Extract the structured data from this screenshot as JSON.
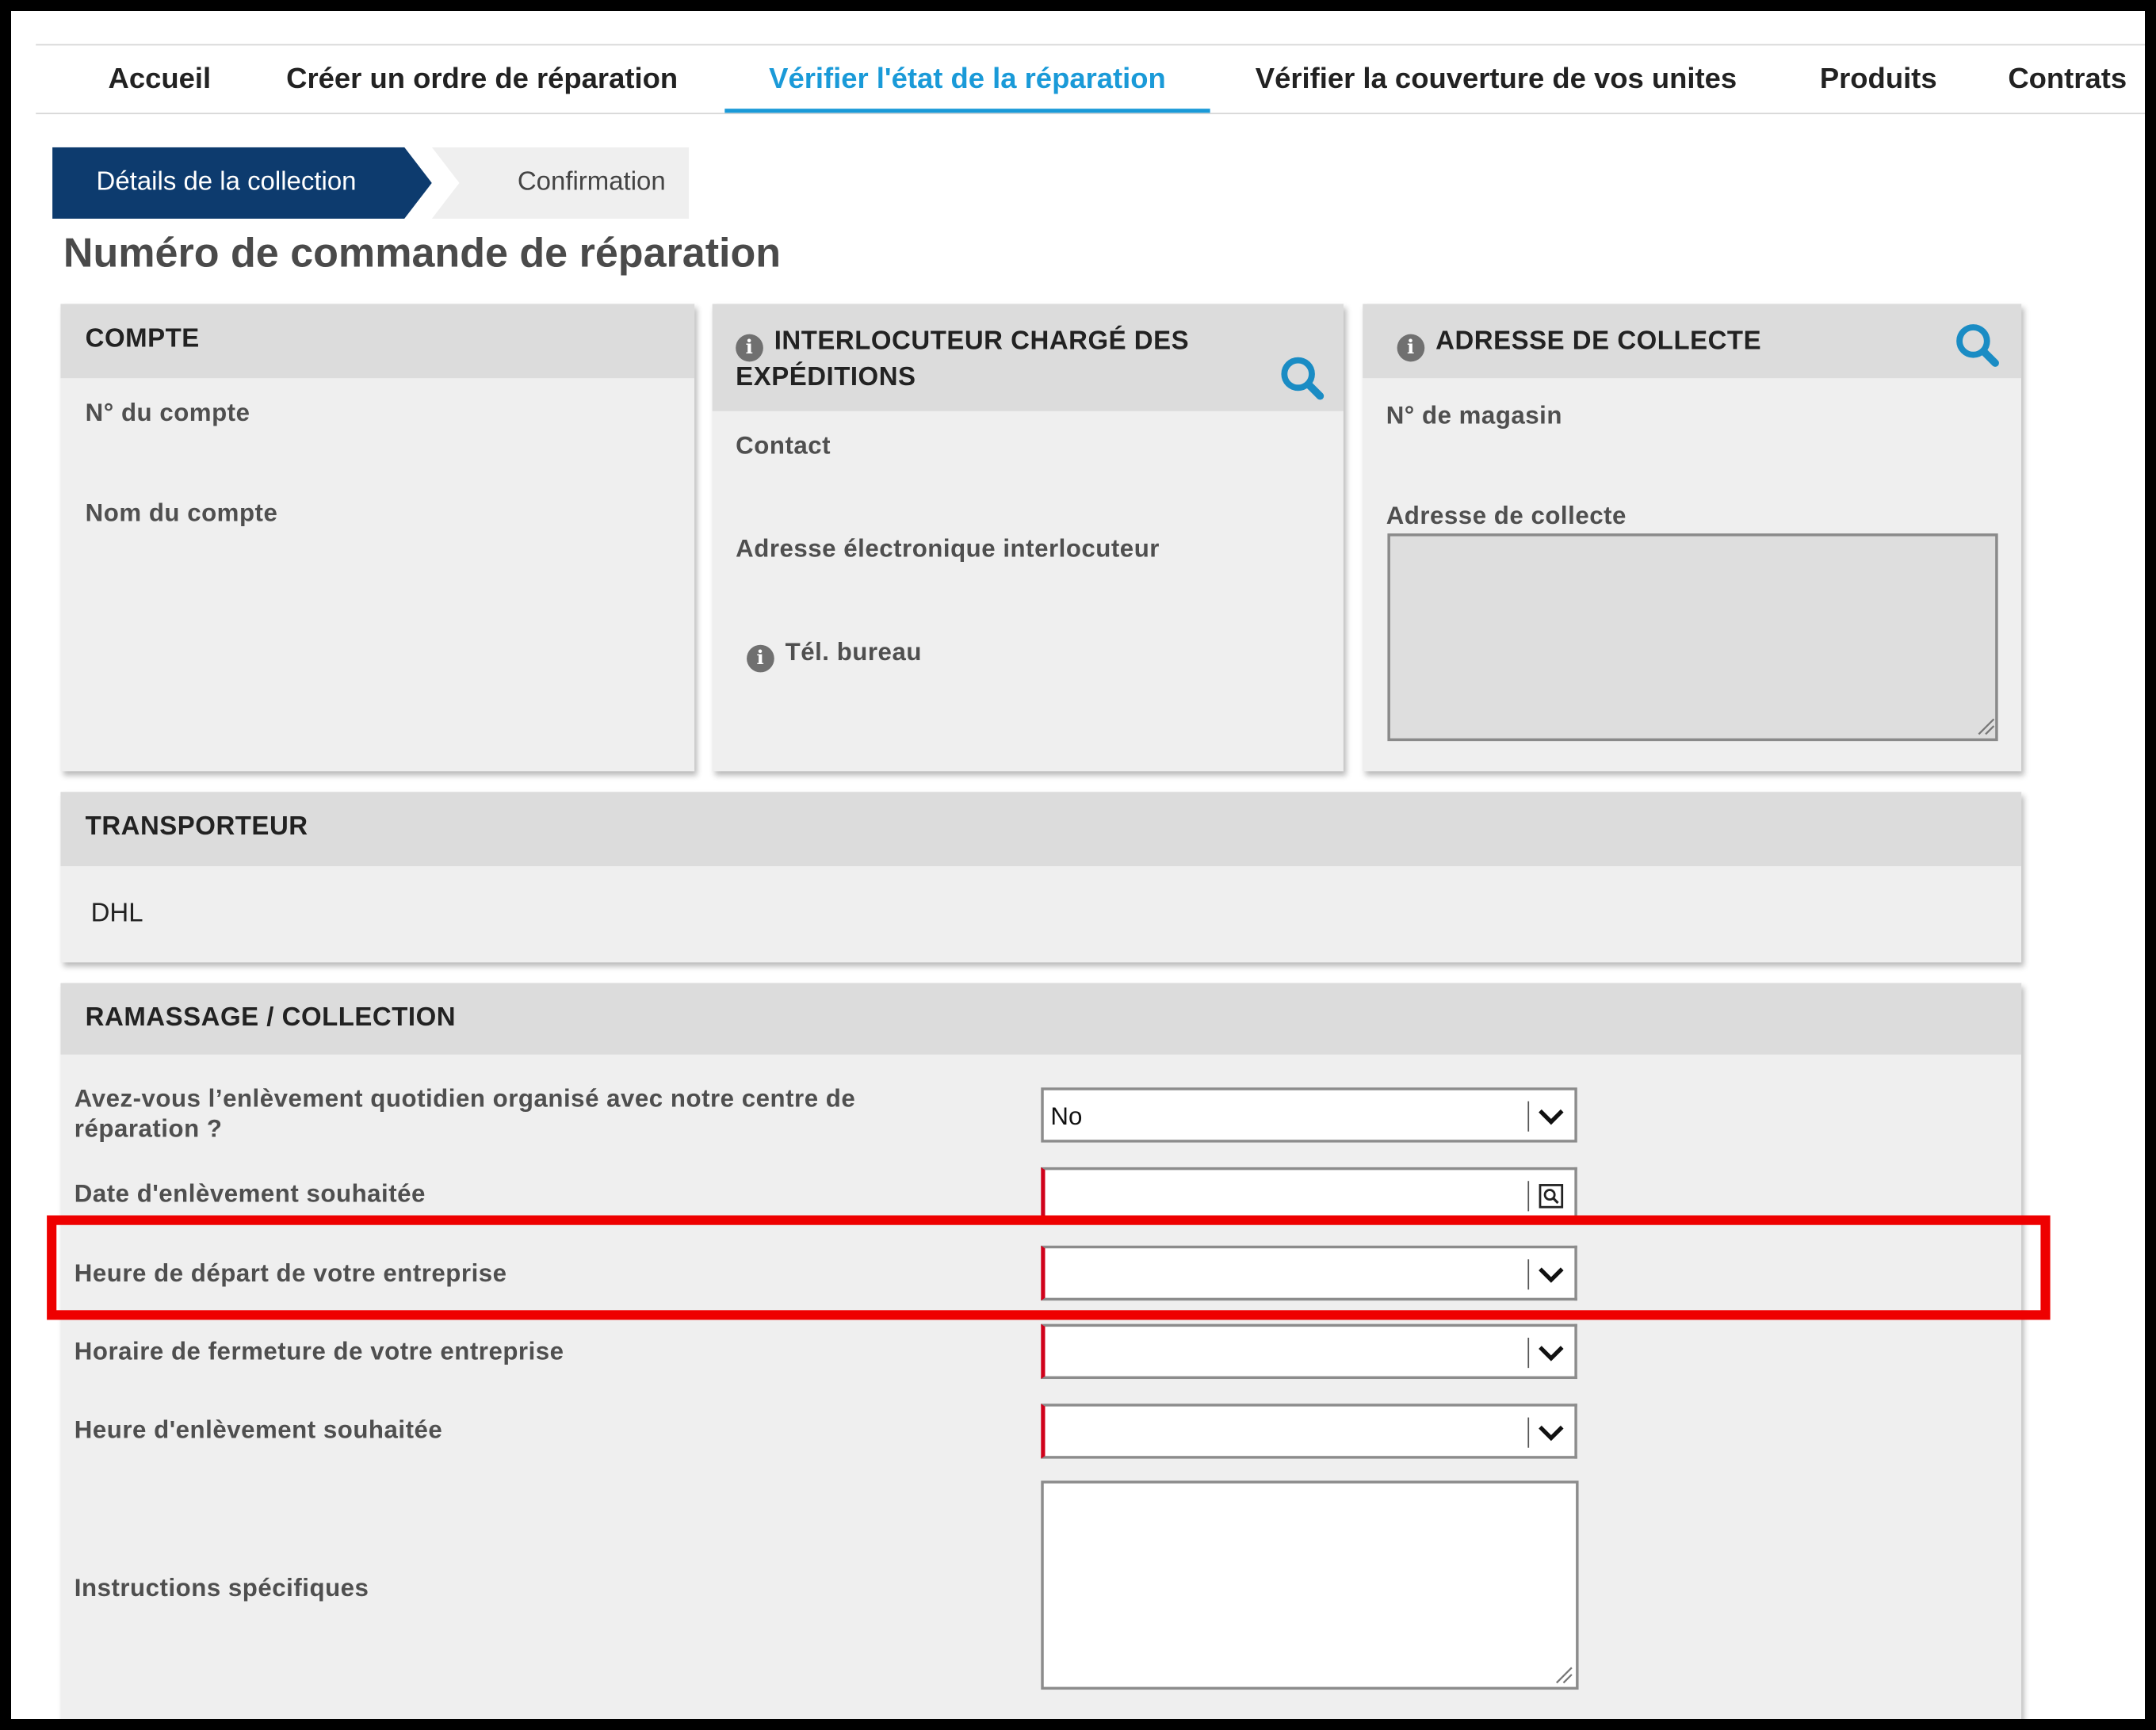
{
  "nav": {
    "items": [
      {
        "label": "Accueil"
      },
      {
        "label": "Créer un ordre de réparation"
      },
      {
        "label": "Vérifier l'état de la réparation"
      },
      {
        "label": "Vérifier la couverture de vos unites"
      },
      {
        "label": "Produits"
      },
      {
        "label": "Contrats"
      }
    ],
    "active_index": 2,
    "accent_color": "#1a9ad8"
  },
  "steps": {
    "current": "Détails de la collection",
    "next": "Confirmation",
    "active_color": "#0d3b6e"
  },
  "page_title": "Numéro de commande de réparation",
  "account": {
    "title": "COMPTE",
    "account_number_label": "N° du compte",
    "account_name_label": "Nom du compte"
  },
  "shipping_contact": {
    "title": "INTERLOCUTEUR CHARGÉ DES EXPÉDITIONS",
    "contact_label": "Contact",
    "email_label": "Adresse électronique interlocuteur",
    "phone_label": "Tél. bureau"
  },
  "pickup_address": {
    "title": "ADRESSE DE COLLECTE",
    "store_number_label": "N° de magasin",
    "address_label": "Adresse de collecte",
    "address_value": ""
  },
  "carrier": {
    "title": "TRANSPORTEUR",
    "value": "DHL"
  },
  "pickup": {
    "title": "RAMASSAGE / COLLECTION",
    "daily_pickup_label": "Avez-vous l’enlèvement quotidien organisé avec notre centre de réparation ?",
    "daily_pickup_value": "No",
    "pickup_date_label": "Date d'enlèvement souhaitée",
    "pickup_date_value": "",
    "departure_time_label": "Heure de départ de votre entreprise",
    "departure_time_value": "",
    "closing_time_label": "Horaire de fermeture de votre entreprise",
    "closing_time_value": "",
    "pickup_time_label": "Heure d'enlèvement souhaitée",
    "pickup_time_value": "",
    "instructions_label": "Instructions spécifiques",
    "instructions_value": ""
  },
  "icons": {
    "search": "search-icon",
    "info": "info-icon",
    "chevron": "chevron-down-icon",
    "calendar": "calendar-icon"
  },
  "colors": {
    "required_marker": "#d0021b",
    "highlight_box": "#ee0000",
    "search_icon": "#1a8cc4"
  }
}
